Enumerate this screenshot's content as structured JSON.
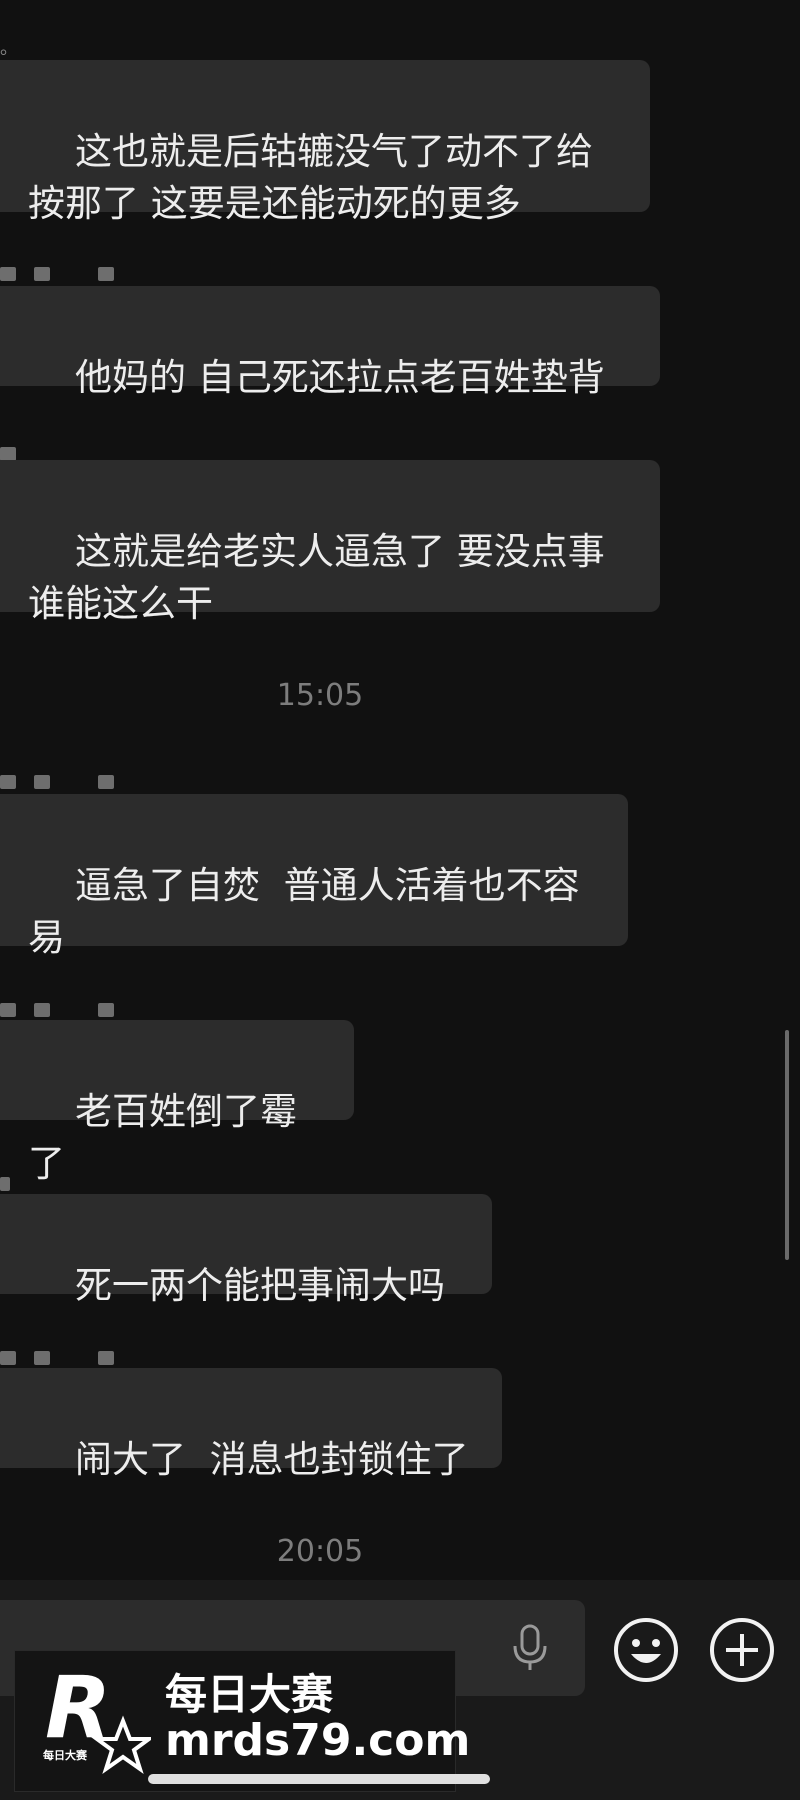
{
  "chat": {
    "leading_mark": "。",
    "messages": [
      {
        "text": "这也就是后轱辘没气了动不了给\n按那了 这要是还能动死的更多"
      },
      {
        "text": "他妈的 自己死还拉点老百姓垫背"
      },
      {
        "text": "这就是给老实人逼急了 要没点事\n谁能这么干"
      },
      {
        "text": "逼急了自焚  普通人活着也不容\n易"
      },
      {
        "text": "老百姓倒了霉了"
      },
      {
        "text": "死一两个能把事闹大吗"
      },
      {
        "text": "闹大了  消息也封锁住了"
      }
    ],
    "timestamps": [
      "15:05",
      "20:05"
    ]
  },
  "input_bar": {
    "icons": [
      "mic-icon",
      "emoji-icon",
      "add-icon"
    ]
  },
  "watermark": {
    "logo_letter": "R",
    "logo_caption": "每日大赛",
    "name": "每日大赛",
    "url": "mrds79.com"
  },
  "colors": {
    "background": "#111111",
    "bubble": "#2c2c2c",
    "text": "#ededed",
    "timestamp": "#7d7d7d"
  }
}
